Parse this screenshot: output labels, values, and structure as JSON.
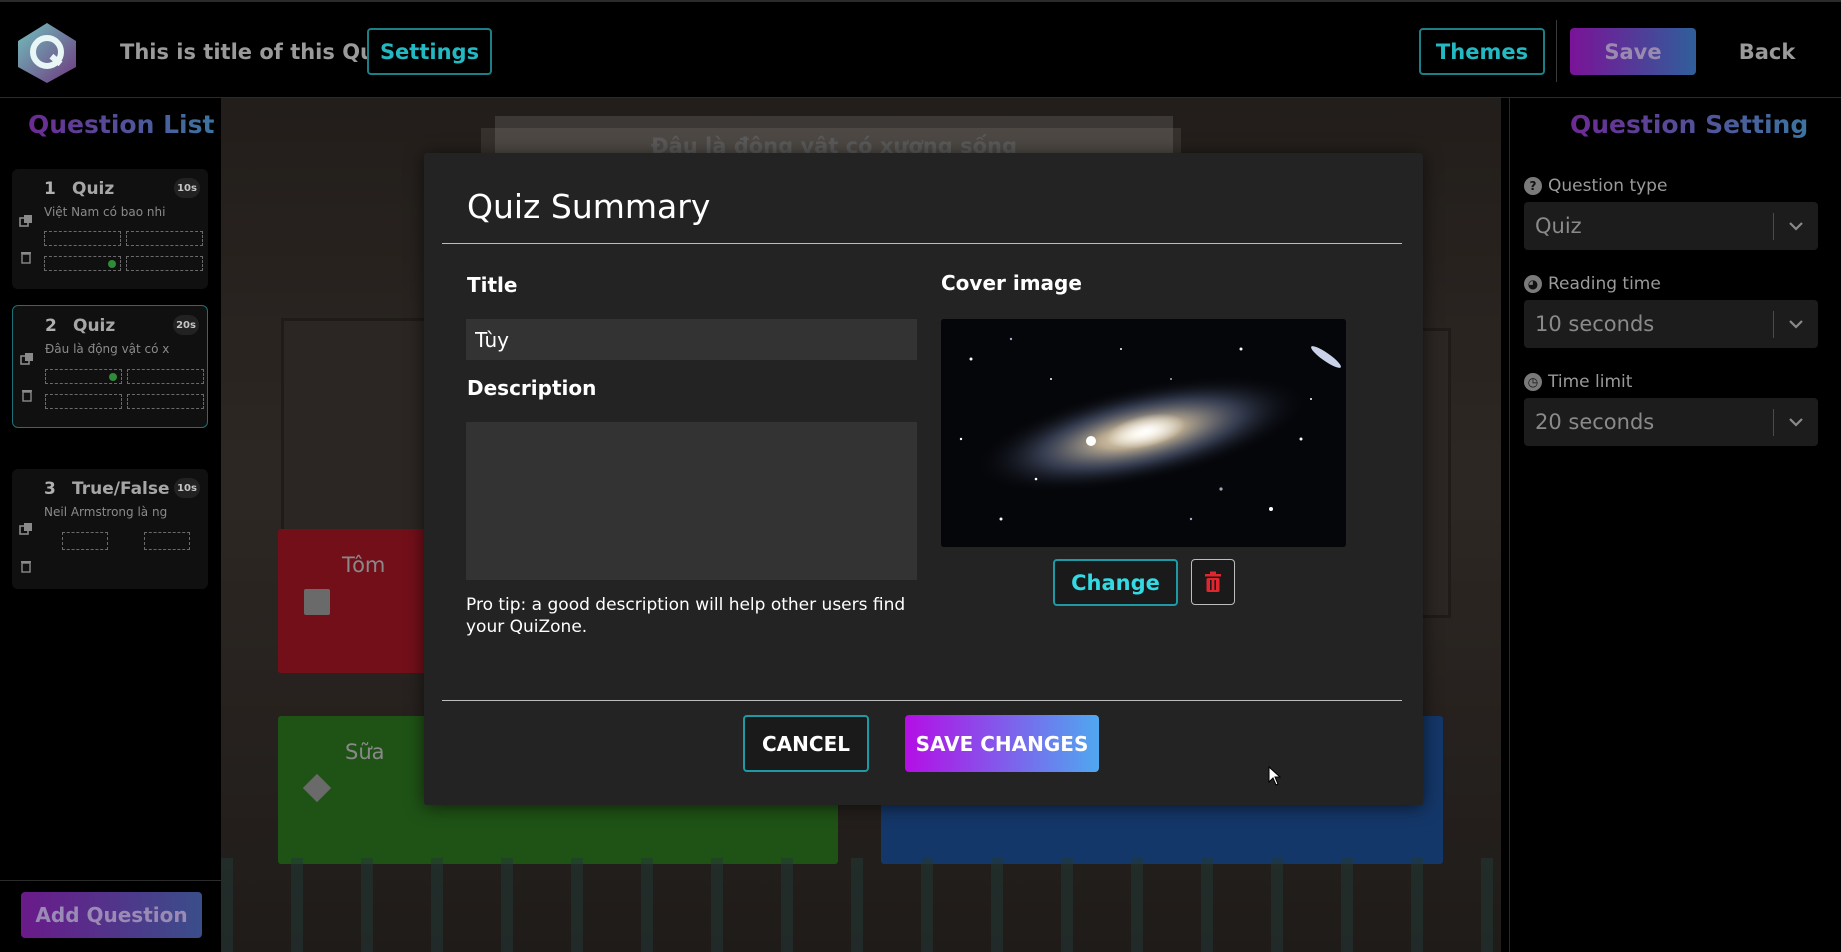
{
  "header": {
    "quiz_title": "This is title of this Quiz",
    "settings_label": "Settings",
    "themes_label": "Themes",
    "save_label": "Save",
    "back_label": "Back"
  },
  "question_list": {
    "heading": "Question List",
    "items": [
      {
        "number": "1",
        "type": "Quiz",
        "time": "10s",
        "text": "Việt Nam có bao nhi"
      },
      {
        "number": "2",
        "type": "Quiz",
        "time": "20s",
        "text": "Đâu là động vật có x"
      },
      {
        "number": "3",
        "type": "True/False",
        "time": "10s",
        "text": "Neil Armstrong là ng"
      }
    ],
    "add_label": "Add Question"
  },
  "editor": {
    "question_title": "Đâu là động vật có xương sống",
    "answers": [
      "Tôm",
      "Sữa"
    ]
  },
  "question_setting": {
    "heading": "Question Setting",
    "question_type_label": "Question type",
    "question_type_value": "Quiz",
    "reading_time_label": "Reading time",
    "reading_time_value": "10 seconds",
    "time_limit_label": "Time limit",
    "time_limit_value": "20 seconds"
  },
  "modal": {
    "title": "Quiz Summary",
    "title_label": "Title",
    "title_value": "Tùy",
    "description_label": "Description",
    "description_value": "",
    "pro_tip": "Pro tip: a good description will help other users find your QuiZone.",
    "cover_label": "Cover image",
    "change_label": "Change",
    "cancel_label": "CANCEL",
    "save_changes_label": "SAVE CHANGES"
  },
  "colors": {
    "accent_teal": "#1d9aa3",
    "gradient_start": "#b40ee6",
    "gradient_end": "#4fa8f0",
    "delete_red": "#e0262f"
  }
}
